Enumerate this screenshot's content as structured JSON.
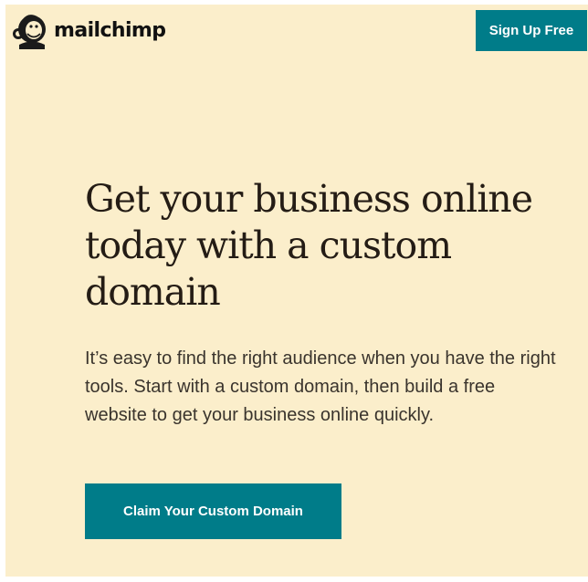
{
  "header": {
    "logo_text": "mailchimp",
    "logo_icon": "freddie-monkey-icon",
    "signup_label": "Sign Up Free"
  },
  "hero": {
    "headline": "Get your business online today with a custom domain",
    "body": "It’s easy to find the right audience when you have the right tools. Start with a custom domain, then build a free website to get your business online quickly.",
    "cta_label": "Claim Your Custom Domain"
  },
  "colors": {
    "background": "#fbeecb",
    "accent": "#007c89",
    "text": "#241c15"
  }
}
